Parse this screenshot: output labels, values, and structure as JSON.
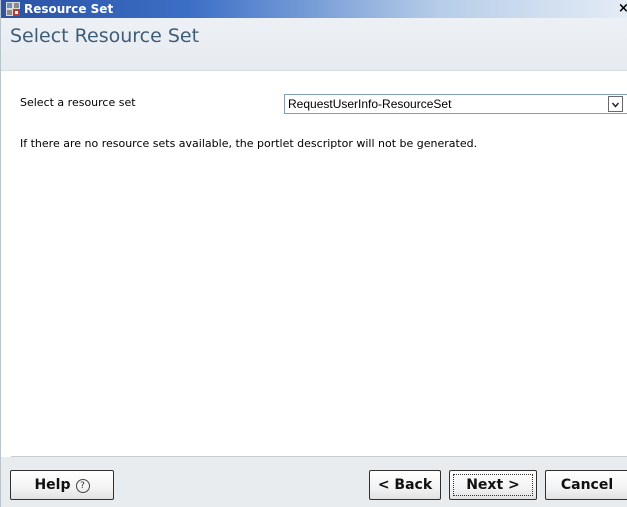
{
  "window": {
    "title": "Resource Set",
    "close_label": "×"
  },
  "header": {
    "title": "Select Resource Set"
  },
  "form": {
    "resource_set_label": "Select a resource set",
    "resource_set_value": "RequestUserInfo-ResourceSet",
    "info_text": "If there are no resource sets available, the portlet descriptor will not be generated."
  },
  "footer": {
    "help_label": "Help",
    "help_icon_glyph": "?",
    "back_label": "< Back",
    "next_label": "Next >",
    "cancel_label": "Cancel"
  },
  "icons": {
    "title_icon": "resource-set-app-icon",
    "close": "close-icon",
    "dropdown": "chevron-down-icon",
    "help": "question-circle-icon"
  },
  "colors": {
    "title_bar_start": "#2b52a3",
    "title_bar_end": "#e4ecf6",
    "page_title": "#3f5d77",
    "header_bg": "#edf1f5",
    "footer_bg": "#e9ecef"
  }
}
